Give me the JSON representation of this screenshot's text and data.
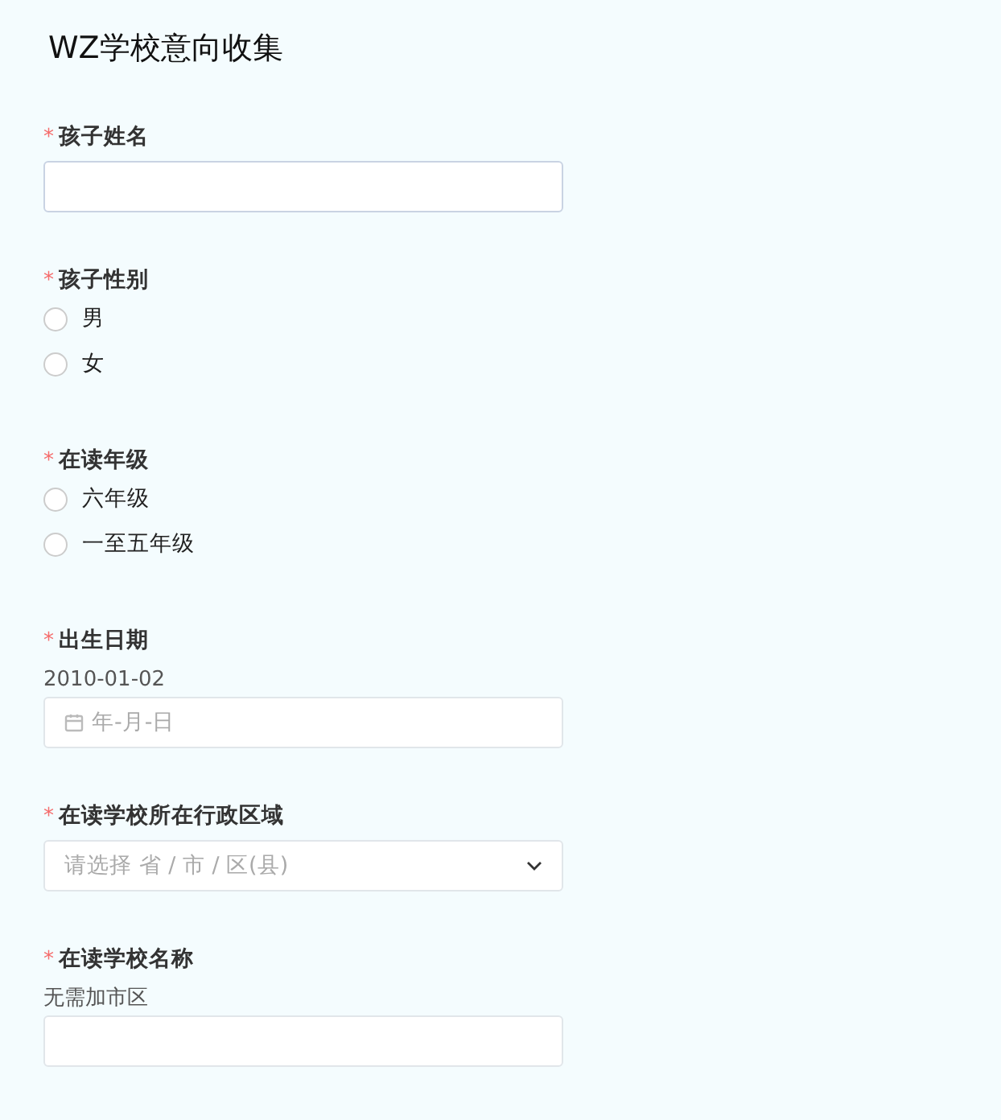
{
  "title": "WZ学校意向收集",
  "fields": [
    {
      "kind": "text",
      "label": "孩子姓名",
      "required": true,
      "marker": "*"
    },
    {
      "kind": "radio",
      "label": "孩子性别",
      "required": true,
      "marker": "*",
      "options": [
        {
          "label": "男",
          "selected": false
        },
        {
          "label": "女",
          "selected": false
        }
      ]
    },
    {
      "kind": "radio",
      "label": "在读年级",
      "required": true,
      "marker": "*",
      "options": [
        {
          "label": "六年级",
          "selected": false
        },
        {
          "label": "一至五年级",
          "selected": false
        }
      ]
    },
    {
      "kind": "date",
      "label": "出生日期",
      "required": true,
      "marker": "*",
      "description": "2010-01-02",
      "placeholder": "年-月-日"
    },
    {
      "kind": "select",
      "label": "在读学校所在行政区域",
      "required": true,
      "marker": "*",
      "placeholder": "请选择 省 / 市 / 区(县)"
    },
    {
      "kind": "text",
      "label": "在读学校名称",
      "required": true,
      "marker": "*",
      "description": "无需加市区"
    }
  ]
}
